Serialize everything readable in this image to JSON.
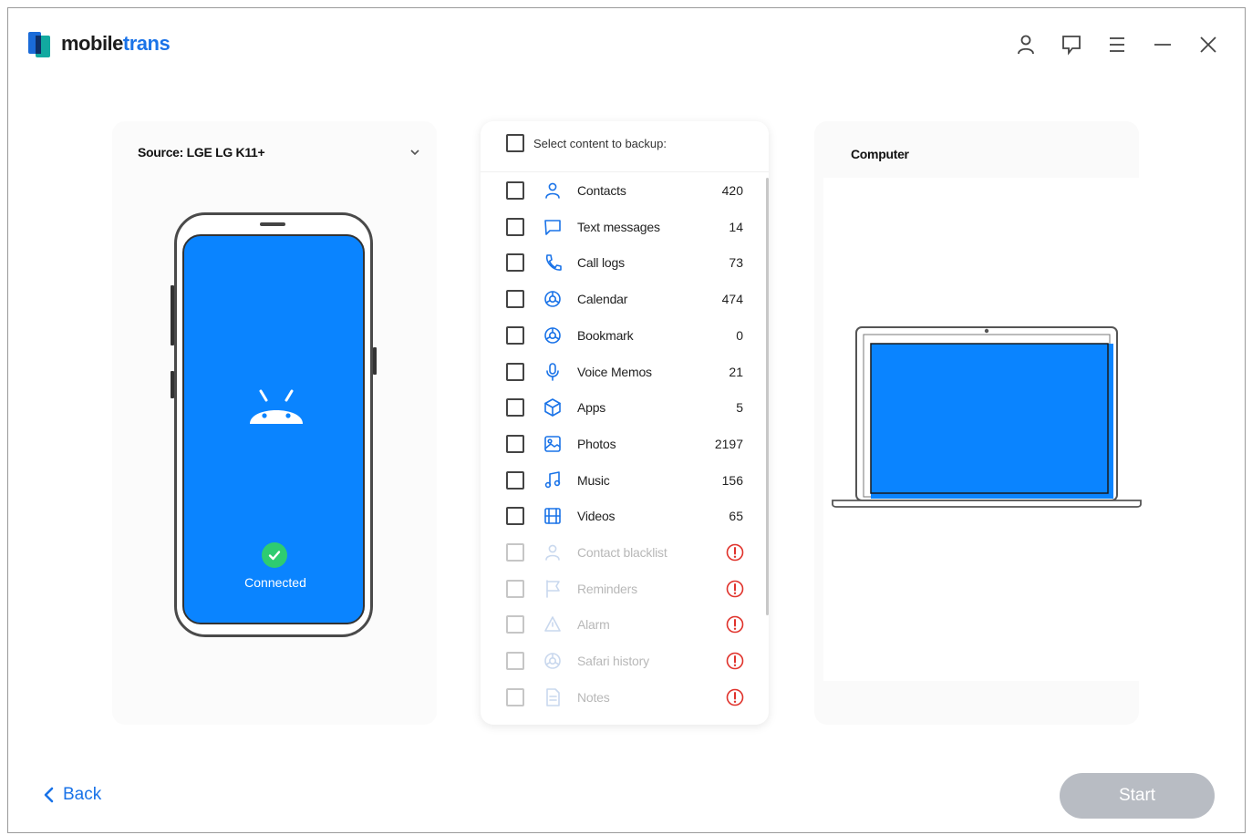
{
  "app": {
    "logo_text_main": "mobile",
    "logo_text_accent": "trans",
    "brand_color": "#1a73e8"
  },
  "window_controls": [
    {
      "name": "account-icon"
    },
    {
      "name": "feedback-icon"
    },
    {
      "name": "menu-icon"
    },
    {
      "name": "minimize-icon"
    },
    {
      "name": "close-icon"
    }
  ],
  "source": {
    "title": "Source: LGE LG K11+",
    "status": "Connected",
    "screen_color": "#0a84ff",
    "status_color": "#2ecc71"
  },
  "list": {
    "header": "Select content to backup:",
    "items": [
      {
        "label": "Contacts",
        "count": "420",
        "icon": "contacts-icon",
        "enabled": true
      },
      {
        "label": "Text messages",
        "count": "14",
        "icon": "message-icon",
        "enabled": true
      },
      {
        "label": "Call logs",
        "count": "73",
        "icon": "phone-icon",
        "enabled": true
      },
      {
        "label": "Calendar",
        "count": "474",
        "icon": "calendar-icon",
        "enabled": true
      },
      {
        "label": "Bookmark",
        "count": "0",
        "icon": "bookmark-icon",
        "enabled": true
      },
      {
        "label": "Voice Memos",
        "count": "21",
        "icon": "microphone-icon",
        "enabled": true
      },
      {
        "label": "Apps",
        "count": "5",
        "icon": "apps-icon",
        "enabled": true
      },
      {
        "label": "Photos",
        "count": "2197",
        "icon": "photo-icon",
        "enabled": true
      },
      {
        "label": "Music",
        "count": "156",
        "icon": "music-icon",
        "enabled": true
      },
      {
        "label": "Videos",
        "count": "65",
        "icon": "video-icon",
        "enabled": true
      },
      {
        "label": "Contact blacklist",
        "count": "",
        "icon": "contacts-icon",
        "enabled": false
      },
      {
        "label": "Reminders",
        "count": "",
        "icon": "flag-icon",
        "enabled": false
      },
      {
        "label": "Alarm",
        "count": "",
        "icon": "alarm-icon",
        "enabled": false
      },
      {
        "label": "Safari history",
        "count": "",
        "icon": "compass-icon",
        "enabled": false
      },
      {
        "label": "Notes",
        "count": "",
        "icon": "notes-icon",
        "enabled": false
      }
    ],
    "icon_color": "#1a73e8",
    "warning_color": "#e0322b"
  },
  "dest": {
    "title": "Computer",
    "screen_color": "#0a84ff"
  },
  "footer": {
    "back_label": "Back",
    "start_label": "Start"
  }
}
